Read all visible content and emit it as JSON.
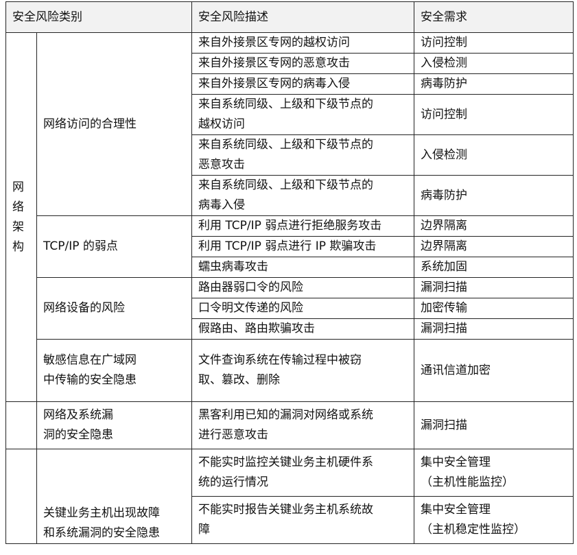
{
  "headers": [
    "安全风险类别",
    "安全风险描述",
    "安全需求"
  ],
  "sections": [
    {
      "category_chars": [
        "网",
        "络",
        "架",
        "构"
      ],
      "groups": [
        {
          "subcategory_lines": [
            "网络访问的合理性"
          ],
          "rows": [
            {
              "desc_lines": [
                "来自外接景区专网的越权访问"
              ],
              "req_lines": [
                "访问控制"
              ]
            },
            {
              "desc_lines": [
                "来自外接景区专网的恶意攻击"
              ],
              "req_lines": [
                "入侵检测"
              ]
            },
            {
              "desc_lines": [
                "来自外接景区专网的病毒入侵"
              ],
              "req_lines": [
                "病毒防护"
              ]
            },
            {
              "desc_lines": [
                "来自系统同级、上级和下级节点的",
                "越权访问"
              ],
              "req_lines": [
                "访问控制"
              ]
            },
            {
              "desc_lines": [
                "来自系统同级、上级和下级节点的",
                "恶意攻击"
              ],
              "req_lines": [
                "入侵检测"
              ]
            },
            {
              "desc_lines": [
                "来自系统同级、上级和下级节点的",
                "病毒入侵"
              ],
              "req_lines": [
                "病毒防护"
              ]
            }
          ]
        },
        {
          "subcategory_lines": [
            "TCP/IP 的弱点"
          ],
          "rows": [
            {
              "desc_lines": [
                "利用 TCP/IP 弱点进行拒绝服务攻击"
              ],
              "req_lines": [
                "边界隔离"
              ]
            },
            {
              "desc_lines": [
                "利用 TCP/IP 弱点进行 IP 欺骗攻击"
              ],
              "req_lines": [
                "边界隔离"
              ]
            },
            {
              "desc_lines": [
                "蠕虫病毒攻击"
              ],
              "req_lines": [
                "系统加固"
              ]
            }
          ]
        },
        {
          "subcategory_lines": [
            "网络设备的风险"
          ],
          "rows": [
            {
              "desc_lines": [
                "路由器弱口令的风险"
              ],
              "req_lines": [
                "漏洞扫描"
              ]
            },
            {
              "desc_lines": [
                "口令明文传递的风险"
              ],
              "req_lines": [
                "加密传输"
              ]
            },
            {
              "desc_lines": [
                "假路由、路由欺骗攻击"
              ],
              "req_lines": [
                "漏洞扫描"
              ]
            }
          ]
        },
        {
          "subcategory_lines": [
            "敏感信息在广域网",
            "中传输的安全隐患"
          ],
          "rows": [
            {
              "desc_lines": [
                "文件查询系统在传输过程中被窃",
                "取、篡改、删除"
              ],
              "req_lines": [
                "通讯信道加密"
              ]
            }
          ]
        }
      ]
    },
    {
      "category_chars": [],
      "groups": [
        {
          "subcategory_lines": [
            "网络及系统漏",
            "洞的安全隐患"
          ],
          "rows": [
            {
              "desc_lines": [
                "黑客利用已知的漏洞对网络或系统",
                "进行恶意攻击"
              ],
              "req_lines": [
                "漏洞扫描"
              ]
            }
          ]
        }
      ]
    },
    {
      "category_chars": [],
      "groups": [
        {
          "subcategory_lines": [
            "关键业务主机出现故障",
            "和系统漏洞的安全隐患"
          ],
          "rows": [
            {
              "desc_lines": [
                "不能实时监控关键业务主机硬件系",
                "统的运行情况"
              ],
              "req_lines": [
                "集中安全管理",
                "（主机性能监控）"
              ]
            },
            {
              "desc_lines": [
                "不能实时报告关键业务主机系统故",
                "障"
              ],
              "req_lines": [
                "集中安全管理",
                "（主机稳定性监控）"
              ]
            }
          ]
        }
      ]
    }
  ]
}
